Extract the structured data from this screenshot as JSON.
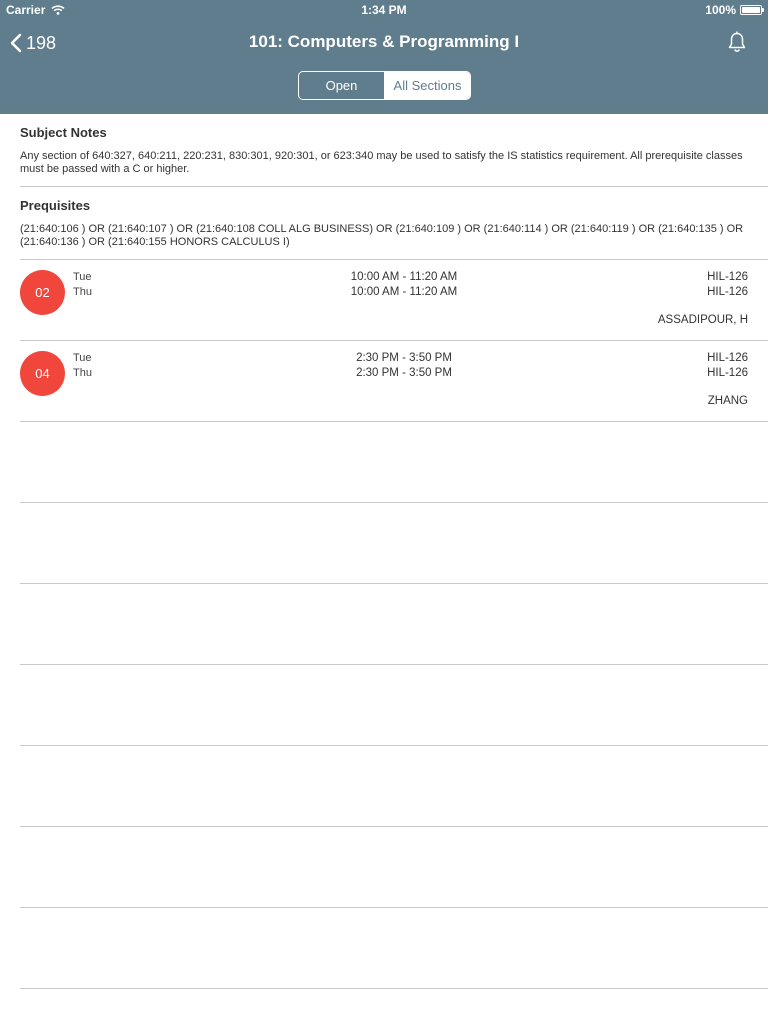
{
  "status_bar": {
    "carrier": "Carrier",
    "time": "1:34 PM",
    "battery": "100%"
  },
  "nav": {
    "back_label": "198",
    "title": "101: Computers & Programming I"
  },
  "segments": {
    "open": "Open",
    "all": "All Sections",
    "selected": "All Sections"
  },
  "subject_notes": {
    "title": "Subject Notes",
    "text": "Any section of 640:327, 640:211, 220:231, 830:301, 920:301, or 623:340 may be used to satisfy the IS statistics requirement. All prerequisite classes must be passed with a C or higher."
  },
  "prerequisites": {
    "title": "Prequisites",
    "text": "(21:640:106 ) OR (21:640:107 ) OR (21:640:108 COLL ALG BUSINESS) OR (21:640:109 ) OR (21:640:114 ) OR (21:640:119 ) OR (21:640:135 ) OR (21:640:136 ) OR (21:640:155 HONORS CALCULUS I)"
  },
  "sections": [
    {
      "number": "02",
      "day1": "Tue",
      "day2": "Thu",
      "time1": "10:00 AM - 11:20 AM",
      "time2": "10:00 AM - 11:20 AM",
      "room1": "HIL-126",
      "room2": "HIL-126",
      "instructor": "ASSADIPOUR, H"
    },
    {
      "number": "04",
      "day1": "Tue",
      "day2": "Thu",
      "time1": "2:30 PM - 3:50 PM",
      "time2": "2:30 PM - 3:50 PM",
      "room1": "HIL-126",
      "room2": "HIL-126",
      "instructor": "ZHANG"
    }
  ],
  "colors": {
    "header": "#5f7d8c",
    "badge": "#f0463b",
    "divider": "#c8c8c8"
  },
  "icons": {
    "back": "chevron-left-icon",
    "bell": "bell-icon",
    "wifi": "wifi-icon",
    "battery": "battery-icon"
  }
}
